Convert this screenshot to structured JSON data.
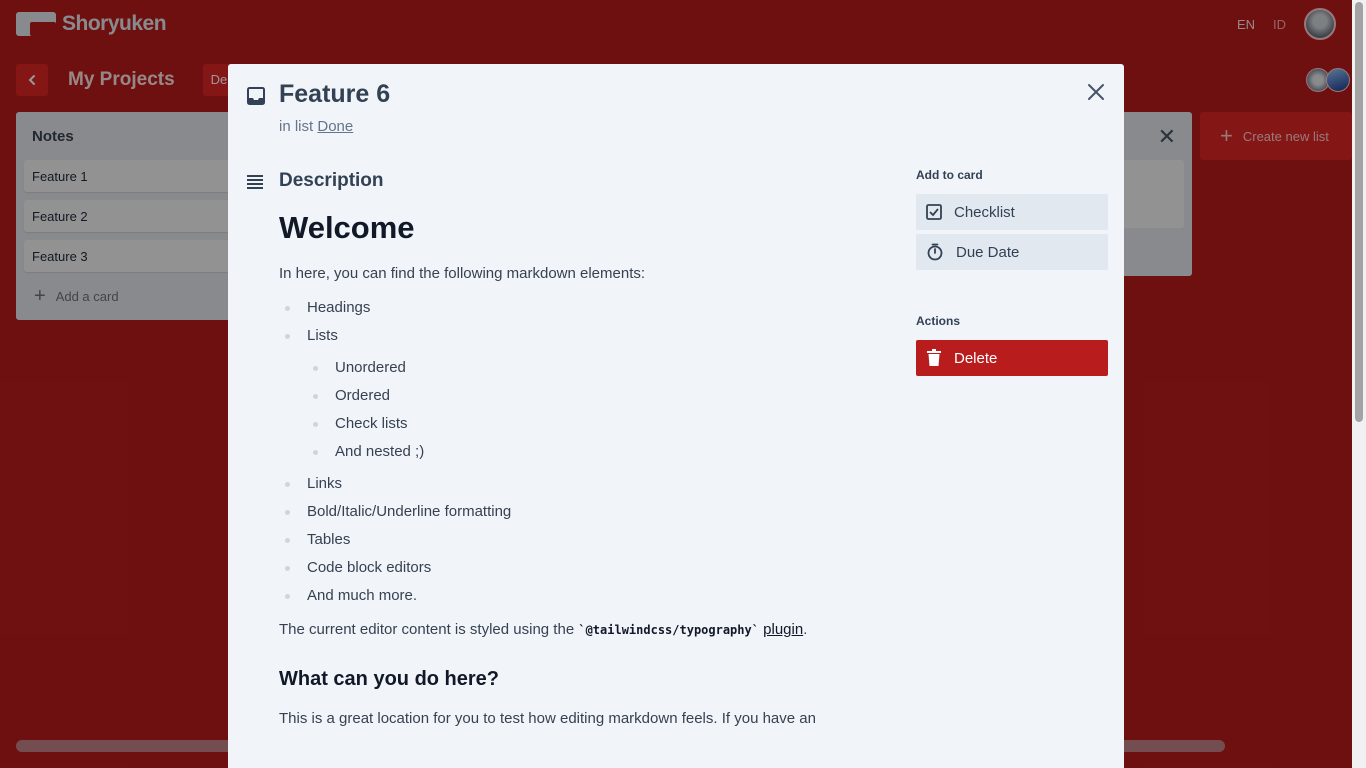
{
  "app": {
    "name": "Shoryuken"
  },
  "languages": [
    "EN",
    "ID"
  ],
  "board": {
    "title": "My Projects",
    "delete_label": "Del"
  },
  "lists": {
    "notes": {
      "title": "Notes",
      "cards": [
        "Feature 1",
        "Feature 2",
        "Feature 3"
      ],
      "add_card_label": "Add a card"
    },
    "create_new_list_label": "Create new list"
  },
  "modal": {
    "title": "Feature 6",
    "list_prefix": "in list",
    "list_name": "Done",
    "description_heading": "Description",
    "content": {
      "h1": "Welcome",
      "intro": "In here, you can find the following markdown elements:",
      "items": {
        "headings": "Headings",
        "lists": "Lists",
        "lists_sub": [
          "Unordered",
          "Ordered",
          "Check lists",
          "And nested ;)"
        ],
        "links": "Links",
        "formatting": "Bold/Italic/Underline formatting",
        "tables": "Tables",
        "code": "Code block editors",
        "more": "And much more."
      },
      "styled_prefix": "The current editor content is styled using the",
      "styled_code": "`@tailwindcss/typography`",
      "styled_link": "plugin",
      "styled_suffix": ".",
      "h2": "What can you do here?",
      "p2": "This is a great location for you to test how editing markdown feels. If you have an"
    },
    "sidebar": {
      "add_to_card_label": "Add to card",
      "checklist_label": "Checklist",
      "due_date_label": "Due Date",
      "actions_label": "Actions",
      "delete_label": "Delete"
    }
  },
  "colors": {
    "brand_red": "#b91c1c",
    "modal_bg": "#f1f5f9",
    "danger": "#b91c1c"
  }
}
